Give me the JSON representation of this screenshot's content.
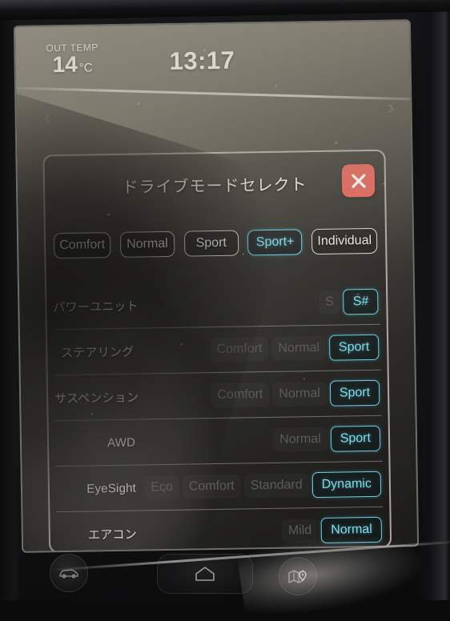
{
  "status_bar": {
    "out_temp_label": "OUT TEMP",
    "out_temp_value": "14",
    "out_temp_unit": "°C",
    "clock": "13:17",
    "prev_arrow": "‹",
    "next_arrow": "›"
  },
  "dialog": {
    "title": "ドライブモードセレクト",
    "close_icon": "close-x-icon",
    "modes": [
      {
        "label": "Comfort",
        "selected": false
      },
      {
        "label": "Normal",
        "selected": false
      },
      {
        "label": "Sport",
        "selected": false
      },
      {
        "label": "Sport+",
        "selected": true
      },
      {
        "label": "Individual",
        "selected": false
      }
    ],
    "rows": [
      {
        "label": "パワーユニット",
        "options": [
          {
            "label": "S",
            "selected": false
          },
          {
            "label": "S#",
            "selected": true
          }
        ]
      },
      {
        "label": "ステアリング",
        "options": [
          {
            "label": "Comfort",
            "selected": false
          },
          {
            "label": "Normal",
            "selected": false
          },
          {
            "label": "Sport",
            "selected": true
          }
        ]
      },
      {
        "label": "サスペンション",
        "options": [
          {
            "label": "Comfort",
            "selected": false
          },
          {
            "label": "Normal",
            "selected": false
          },
          {
            "label": "Sport",
            "selected": true
          }
        ]
      },
      {
        "label": "AWD",
        "options": [
          {
            "label": "Normal",
            "selected": false
          },
          {
            "label": "Sport",
            "selected": true
          }
        ]
      },
      {
        "label": "EyeSight",
        "options": [
          {
            "label": "Eco",
            "selected": false
          },
          {
            "label": "Comfort",
            "selected": false
          },
          {
            "label": "Standard",
            "selected": false
          },
          {
            "label": "Dynamic",
            "selected": true
          }
        ]
      },
      {
        "label": "エアコン",
        "options": [
          {
            "label": "Mild",
            "selected": false
          },
          {
            "label": "Normal",
            "selected": true
          }
        ]
      }
    ]
  },
  "hardware_buttons": [
    {
      "name": "car-button",
      "icon": "car-icon"
    },
    {
      "name": "home-button",
      "icon": "home-icon"
    },
    {
      "name": "map-button",
      "icon": "map-icon"
    }
  ],
  "colors": {
    "accent_cyan": "#6fd6e8",
    "close_red": "#e8695f",
    "text_light": "#efeee9",
    "text_dim": "#5c5c5a"
  }
}
